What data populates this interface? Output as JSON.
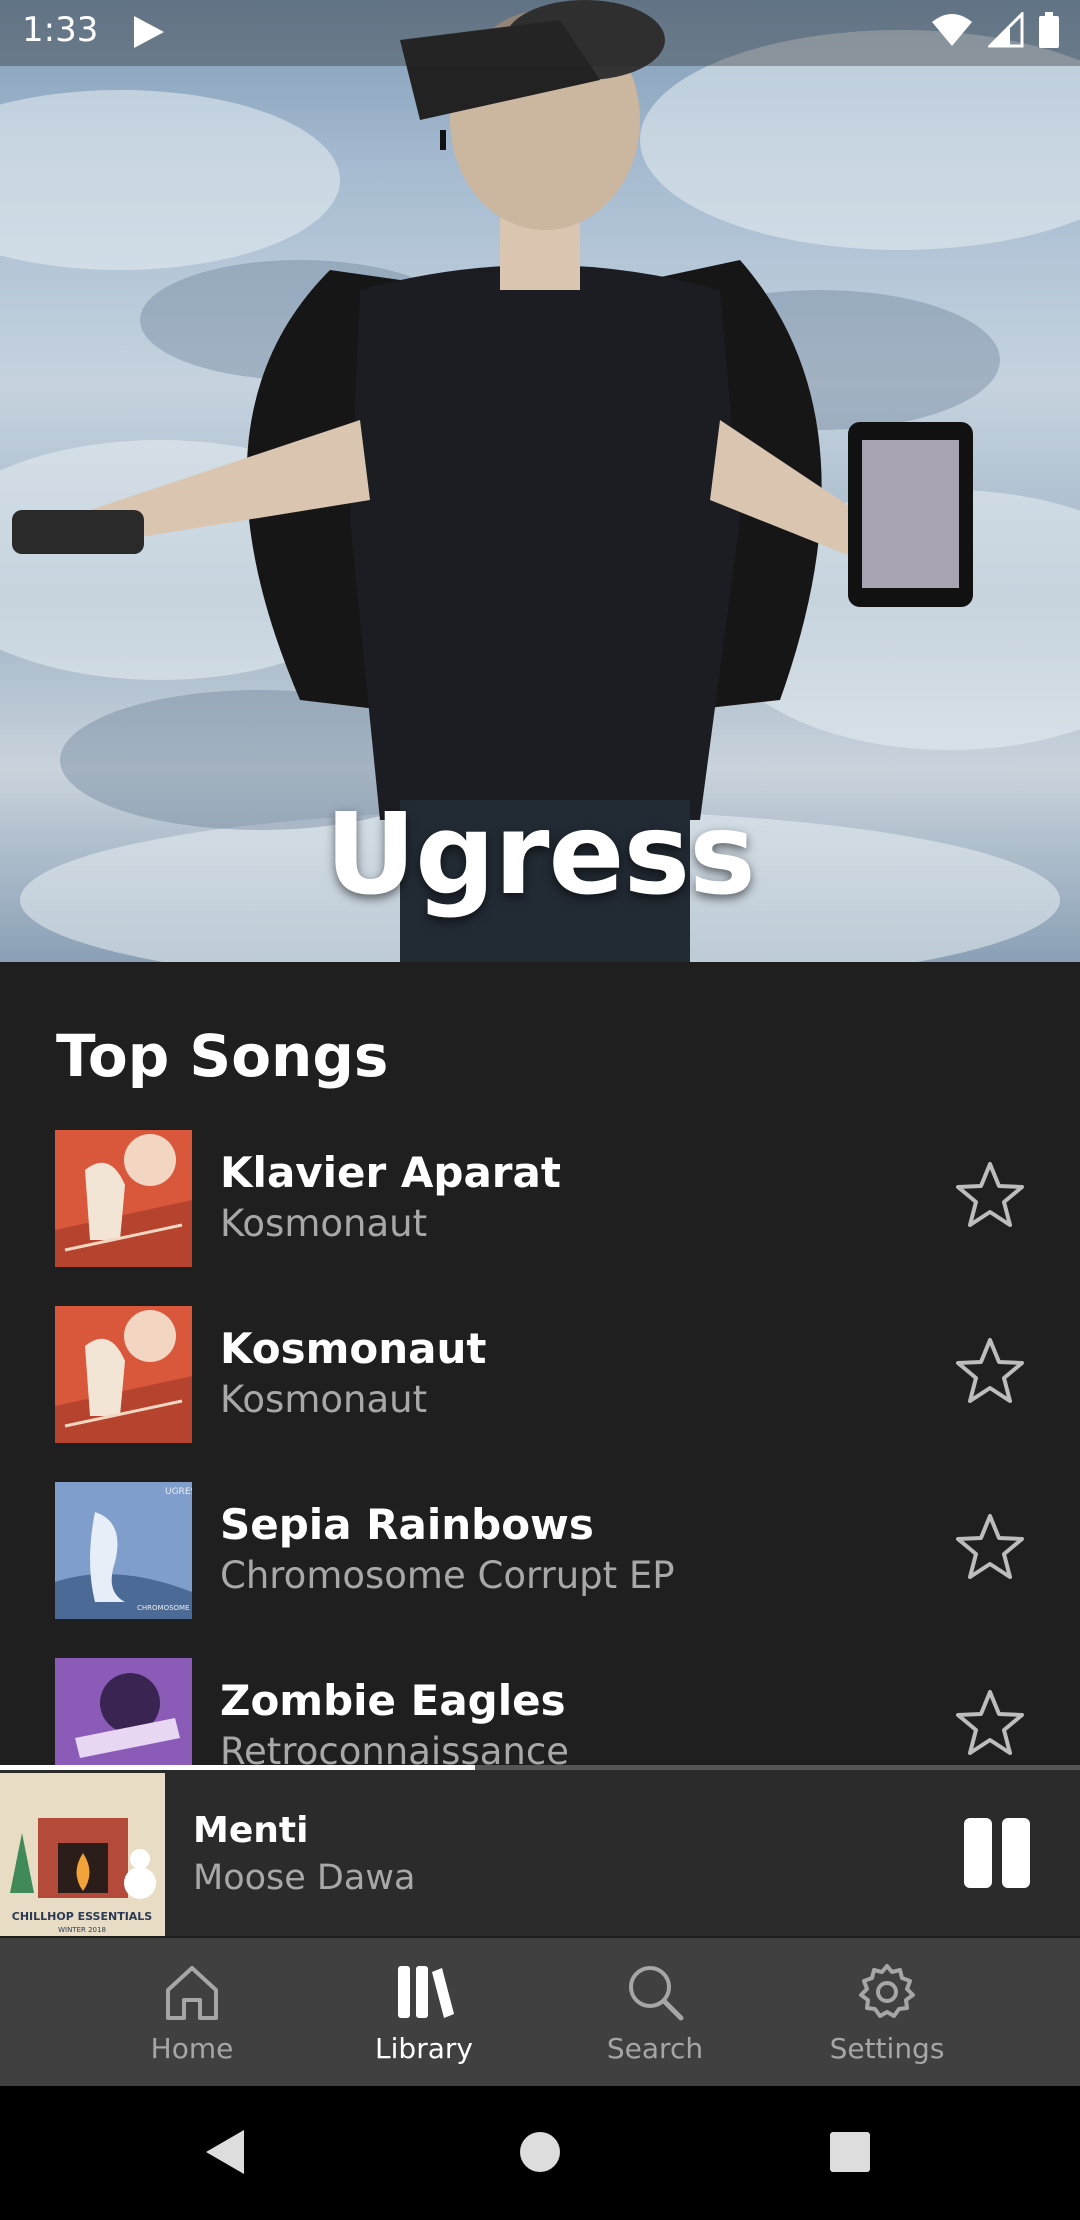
{
  "status_bar": {
    "time": "1:33"
  },
  "artist": {
    "name": "Ugress"
  },
  "top_songs": {
    "heading": "Top Songs",
    "items": [
      {
        "title": "Klavier Aparat",
        "album": "Kosmonaut"
      },
      {
        "title": "Kosmonaut",
        "album": "Kosmonaut"
      },
      {
        "title": "Sepia Rainbows",
        "album": "Chromosome Corrupt EP"
      },
      {
        "title": "Zombie Eagles",
        "album": "Retroconnaissance"
      }
    ]
  },
  "now_playing": {
    "title": "Menti",
    "artist": "Moose Dawa",
    "progress": 0.44,
    "art_text": "CHILLHOP ESSENTIALS",
    "art_subtext": "WINTER 2018"
  },
  "album_art_text": {
    "sepia_top": "UGRESS",
    "sepia_bottom": "CHROMOSOME CORRUPT"
  },
  "bottom_nav": {
    "home": "Home",
    "library": "Library",
    "search": "Search",
    "settings": "Settings",
    "active": "library"
  },
  "colors": {
    "background": "#1f1f20",
    "now_playing_bg": "#2b2b2c",
    "nav_bg": "#404041",
    "secondary_text": "#a8a8a8"
  }
}
